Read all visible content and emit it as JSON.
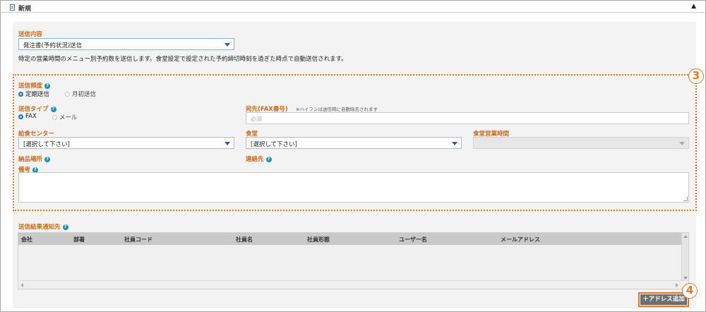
{
  "header": {
    "title": "新規",
    "collapse_icon": "▲"
  },
  "send_content": {
    "label": "送信内容",
    "selected": "発注書(予約状況)送信",
    "description": "特定の営業時間のメニュー別予約数を送信します。食堂設定で設定された予約締切時刻を過ぎた時点で自動送信されます。"
  },
  "frequency": {
    "label": "送信頻度",
    "options": [
      {
        "label": "定期送信",
        "selected": true
      },
      {
        "label": "月初送信",
        "selected": false
      }
    ]
  },
  "send_type": {
    "label": "送信タイプ",
    "options": [
      {
        "label": "FAX",
        "selected": true
      },
      {
        "label": "メール",
        "selected": false
      }
    ]
  },
  "destination": {
    "label": "宛先(FAX番号)",
    "note": "※ハイフンは送信時に自動除去されます",
    "placeholder": "必須"
  },
  "kitchen_center": {
    "label": "給食センター",
    "selected": "[選択して下さい]"
  },
  "cafeteria": {
    "label": "食堂",
    "selected": "[選択して下さい]"
  },
  "cafeteria_hours": {
    "label": "食堂営業時間",
    "selected": ""
  },
  "delivery_place": {
    "label": "納品場所"
  },
  "contact": {
    "label": "連絡先"
  },
  "remarks": {
    "label": "備考"
  },
  "result_notify": {
    "label": "送信結果通知先",
    "columns": [
      "会社",
      "部署",
      "社員コード",
      "社員名",
      "社員形態",
      "ユーザー名",
      "メールアドレス"
    ]
  },
  "add_address_button": {
    "label": "＋アドレス追加"
  },
  "callouts": {
    "three": "3",
    "four": "4"
  },
  "colors": {
    "accent": "#c96a1a",
    "callout": "#e07722",
    "help": "#1b93b3",
    "radio": "#1e6fd0"
  }
}
